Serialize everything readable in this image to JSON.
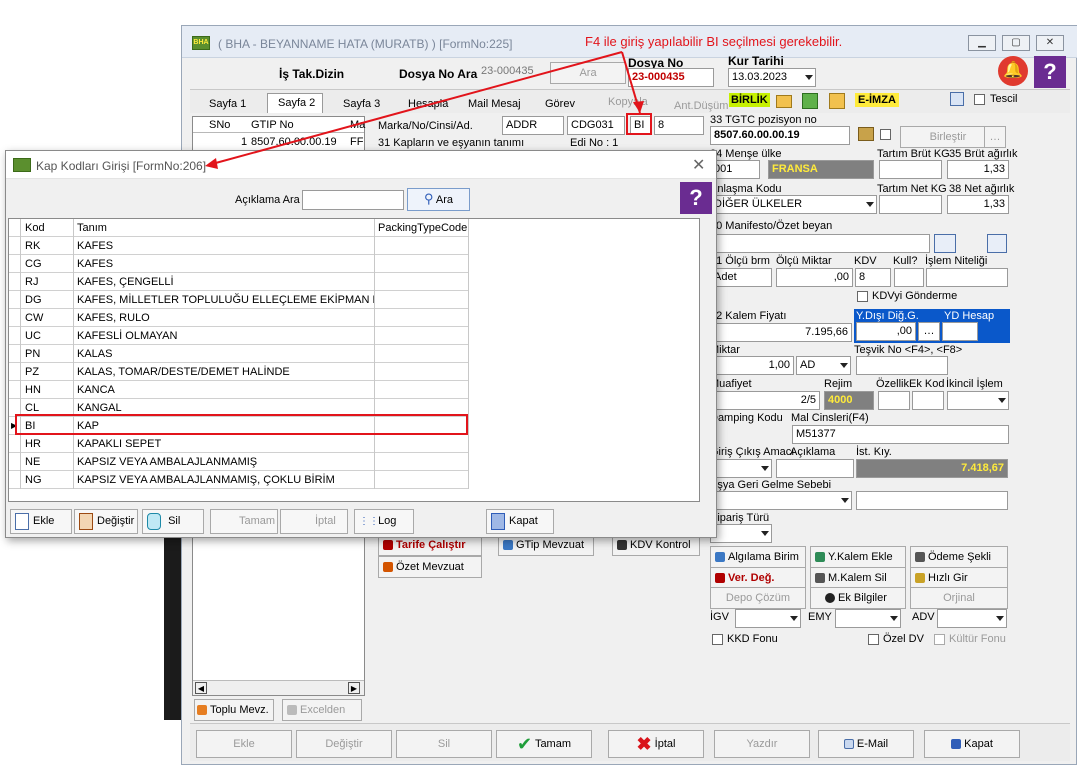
{
  "annotation": {
    "text": "F4 ile giriş yapılabilir BI seçilmesi gerekebilir."
  },
  "main_window": {
    "title": "( BHA - BEYANNAME HATA (MURATB) ) [FormNo:225]",
    "app_icon_text": "BHA",
    "is_takip_label": "İş Tak.Dizin",
    "dosya_ara_label": "Dosya No Ara",
    "dosya_ara_value": "23-000435",
    "ara_button": "Ara",
    "dosya_no_label": "Dosya No",
    "dosya_no_value": "23-000435",
    "kur_tarihi_label": "Kur Tarihi",
    "kur_tarihi_value": "13.03.2023",
    "tabs": [
      {
        "label": "Sayfa 1"
      },
      {
        "label": "Sayfa 2"
      },
      {
        "label": "Sayfa 3"
      },
      {
        "label": "Hesapla"
      },
      {
        "label": "Mail Mesaj"
      },
      {
        "label": "Görev"
      },
      {
        "label": "Kopyala"
      },
      {
        "label": "Ant.Düşüm"
      }
    ],
    "birlik_badge": "BİRLİK",
    "eimza_badge": "E-İMZA",
    "tescil_label": "Tescil",
    "left_grid": {
      "headers": [
        "SNo",
        "GTIP No",
        "Ma"
      ],
      "row": {
        "sno": "1",
        "gtip": "8507.60.00.00.19",
        "ma": "FF"
      }
    },
    "marka_label": "Marka/No/Cinsi/Ad.",
    "marka_value": "ADDR",
    "kap_code_value": "CDG031",
    "bi_value": "BI",
    "count_value": "8",
    "kaplarin_label": "31 Kapların ve eşyanın tanımı",
    "edi_label": "Edi No : 1",
    "tgtc_label": "33 TGTC pozisyon no",
    "tgtc_value": "8507.60.00.00.19",
    "birlestir_button": "Birleştir",
    "mense_label": "34 Menşe ülke",
    "mense_code": "001",
    "mense_name": "FRANSA",
    "tartim_brut_label": "Tartım Brüt KG",
    "brut_agirlik_label": "35 Brüt ağırlık",
    "brut_agirlik_value": "1,33",
    "anlasma_label": "Anlaşma Kodu",
    "anlasma_value": "DİĞER ÜLKELER",
    "tartim_net_label": "Tartım Net KG",
    "net_agirlik_label": "38 Net ağırlık",
    "net_agirlik_value": "1,33",
    "manifesto_label": "40 Manifesto/Özet beyan",
    "olcu_brm_label": "41 Ölçü brm",
    "olcu_brm_value": "Adet",
    "olcu_miktar_label": "Ölçü Miktar",
    "olcu_miktar_value": ",00",
    "kdv_label": "KDV",
    "kdv_value": "8",
    "kull_label": "Kull?",
    "islem_niteligi_label": "İşlem Niteliği",
    "kdv_gonderme_label": "KDVyi Gönderme",
    "kalem_fiyati_label": "42 Kalem Fiyatı",
    "kalem_fiyati_value": "7.195,66",
    "y_disi_label": "Y.Dışı Diğ.G.",
    "y_disi_value": ",00",
    "yd_hesap_label": "YD Hesap",
    "miktar_label": "Miktar",
    "miktar_value": "1,00",
    "miktar_unit": "AD",
    "tesvik_label": "Teşvik No <F4>, <F8>",
    "muafiyet_label": "Muafiyet",
    "muafiyet_value": "2/5",
    "rejim_label": "Rejim",
    "rejim_value": "4000",
    "ozellik_label": "Özellik",
    "ek_kod_label": "Ek Kod",
    "ikincil_islem_label": "İkincil İşlem",
    "damping_label": "Damping Kodu",
    "mal_cinsleri_label": "Mal Cinsleri(F4)",
    "mal_cinsleri_value": "M51377",
    "giris_cikis_label": "Giriş Çıkış Amacı",
    "aciklama_label": "Açıklama",
    "ist_kiy_label": "İst. Kıy.",
    "ist_kiy_value": "7.418,67",
    "esya_geri_label": "Eşya Geri Gelme Sebebi",
    "siparis_turu_label": "Sipariş Türü",
    "tarife_button": "Tarife Çalıştır",
    "gtip_mevzuat_button": "GTip Mevzuat",
    "kdv_kontrol_button": "KDV Kontrol",
    "ozet_mevzuat_button": "Özet Mevzuat",
    "algilama_button": "Algılama Birim",
    "y_kalem_ekle_button": "Y.Kalem Ekle",
    "odeme_sekli_button": "Ödeme Şekli",
    "ver_deg_button": "Ver. Değ.",
    "m_kalem_sil_button": "M.Kalem Sil",
    "hizli_gir_button": "Hızlı Gir",
    "depo_cozum_button": "Depo Çözüm",
    "ek_bilgiler_button": "Ek Bilgiler",
    "orjinal_button": "Orjinal",
    "igv_label": "İGV",
    "emy_label": "EMY",
    "adv_label": "ADV",
    "kkd_fonu_label": "KKD Fonu",
    "ozel_dv_label": "Özel DV",
    "kultur_fonu_label": "Kültür Fonu",
    "toplu_mevz_button": "Toplu Mevz.",
    "excelden_button": "Excelden",
    "bottom_buttons": {
      "ekle": "Ekle",
      "degistir": "Değiştir",
      "sil": "Sil",
      "tamam": "Tamam",
      "iptal": "İptal",
      "yazdir": "Yazdır",
      "email": "E-Mail",
      "kapat": "Kapat"
    }
  },
  "dialog": {
    "title": "Kap Kodları Girişi [FormNo:206]",
    "aciklama_ara_label": "Açıklama Ara",
    "aciklama_ara_value": "",
    "ara_button": "Ara",
    "columns": [
      "Kod",
      "Tanım",
      "PackingTypeCode"
    ],
    "rows": [
      {
        "kod": "RK",
        "tanim": "KAFES",
        "packing": ""
      },
      {
        "kod": "CG",
        "tanim": "KAFES",
        "packing": ""
      },
      {
        "kod": "RJ",
        "tanim": "KAFES, ÇENGELLİ",
        "packing": ""
      },
      {
        "kod": "DG",
        "tanim": "KAFES, MİLLETLER TOPLULUĞU ELLEÇLEME EKİPMAN HA",
        "packing": ""
      },
      {
        "kod": "CW",
        "tanim": "KAFES, RULO",
        "packing": ""
      },
      {
        "kod": "UC",
        "tanim": "KAFESLİ OLMAYAN",
        "packing": ""
      },
      {
        "kod": "PN",
        "tanim": "KALAS",
        "packing": ""
      },
      {
        "kod": "PZ",
        "tanim": "KALAS, TOMAR/DESTE/DEMET HALİNDE",
        "packing": ""
      },
      {
        "kod": "HN",
        "tanim": "KANCA",
        "packing": ""
      },
      {
        "kod": "CL",
        "tanim": "KANGAL",
        "packing": ""
      },
      {
        "kod": "BI",
        "tanim": "KAP",
        "packing": ""
      },
      {
        "kod": "HR",
        "tanim": "KAPAKLI SEPET",
        "packing": ""
      },
      {
        "kod": "NE",
        "tanim": "KAPSIZ VEYA AMBALAJLANMAMIŞ",
        "packing": ""
      },
      {
        "kod": "NG",
        "tanim": "KAPSIZ VEYA AMBALAJLANMAMIŞ, ÇOKLU BİRİM",
        "packing": ""
      }
    ],
    "buttons": {
      "ekle": "Ekle",
      "degistir": "Değiştir",
      "sil": "Sil",
      "tamam": "Tamam",
      "iptal": "İptal",
      "log": "Log",
      "kapat": "Kapat"
    }
  },
  "colors": {
    "annotation_red": "#e2141b",
    "selection_blue": "#0a58ca",
    "accent_yellow": "#ffeb3b",
    "dark_value_bg": "#808080",
    "badge_green": "#c6f000"
  }
}
